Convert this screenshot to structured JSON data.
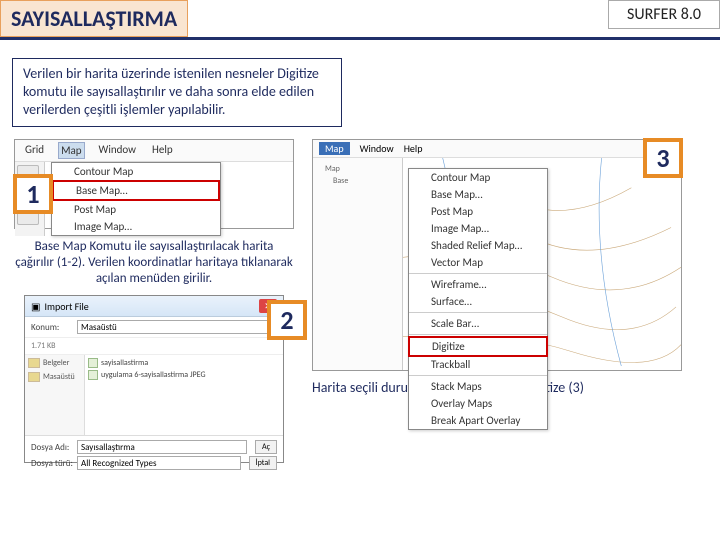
{
  "header": {
    "title": "SAYISALLAŞTIRMA",
    "version": "SURFER 8.0"
  },
  "intro": "Verilen bir harita üzerinde istenilen nesneler Digitize komutu ile sayısallaştırılır ve daha sonra elde edilen verilerden çeşitli işlemler yapılabilir.",
  "step1": {
    "badge": "1",
    "menubar": [
      "Grid",
      "Map",
      "Window",
      "Help"
    ],
    "dropdown": [
      "Contour Map",
      "Base Map…",
      "Post Map",
      "Image Map…"
    ],
    "highlight_index": 1
  },
  "caption1": "Base Map Komutu ile sayısallaştırılacak harita çağırılır (1-2). Verilen koordinatlar haritaya tıklanarak açılan menüden girilir.",
  "step2": {
    "badge": "2",
    "dialog_title": "Import File",
    "konum_label": "Konum:",
    "konum_value": "Masaüstü",
    "size": "1.71 KB",
    "side_items": [
      "Belgeler",
      "Masaüstü"
    ],
    "files": [
      "sayisallastirma",
      "uygulama 6-sayisallastirma JPEG"
    ],
    "filename_label": "Dosya Adı:",
    "filename_value": "Sayısallaştırma",
    "filetype_label": "Dosya türü:",
    "filetype_value": "All Recognized Types",
    "btn_open": "Aç",
    "btn_cancel": "İptal"
  },
  "step3": {
    "badge": "3",
    "menubar": [
      "Map",
      "Window",
      "Help"
    ],
    "tree": [
      "Map",
      "Base"
    ],
    "dropdown": [
      "Contour Map",
      "Base Map…",
      "Post Map",
      "Image Map…",
      "Shaded Relief Map…",
      "Vector Map",
      "Wireframe…",
      "Surface…",
      "Scale Bar…",
      "Digitize",
      "Trackball",
      "Stack Maps",
      "Overlay Maps",
      "Break Apart Overlay"
    ],
    "highlight_index": 9
  },
  "caption2": "Harita seçili durumdayken → Map → Digitize (3)"
}
